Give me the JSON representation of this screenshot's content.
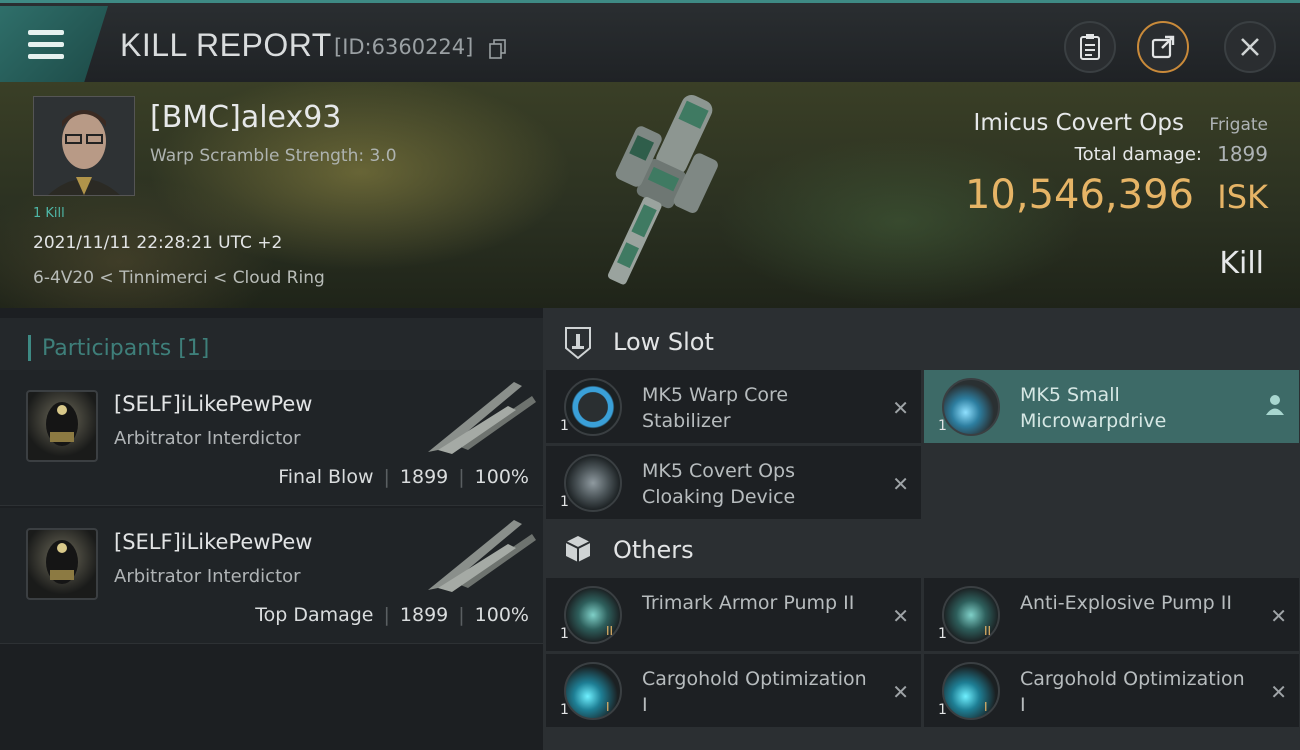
{
  "header": {
    "title": "KILL REPORT",
    "report_id": "[ID:6360224]"
  },
  "victim": {
    "pilot": "[BMC]alex93",
    "warp_scramble": "Warp Scramble Strength: 3.0",
    "kills_tag": "1 Kill",
    "datetime": "2021/11/11 22:28:21 UTC +2",
    "location": "6-4V20 < Tinnimerci < Cloud Ring",
    "ship_name": "Imicus Covert Ops",
    "ship_class": "Frigate",
    "total_damage_label": "Total damage:",
    "total_damage": "1899",
    "isk_value": "10,546,396",
    "isk_unit": "ISK",
    "result": "Kill"
  },
  "participants": {
    "header": "Participants [1]",
    "rows": [
      {
        "name": "[SELF]iLikePewPew",
        "ship": "Arbitrator Interdictor",
        "tag": "Final Blow",
        "damage": "1899",
        "percent": "100%"
      },
      {
        "name": "[SELF]iLikePewPew",
        "ship": "Arbitrator Interdictor",
        "tag": "Top Damage",
        "damage": "1899",
        "percent": "100%"
      }
    ]
  },
  "modules": {
    "low_slot_label": "Low Slot",
    "others_label": "Others",
    "low_slot": [
      {
        "qty": "1",
        "name": "MK5 Warp Core Stabilizer",
        "state": "destroyed"
      },
      {
        "qty": "1",
        "name": "MK5 Small Microwarpdrive",
        "state": "dropped"
      },
      {
        "qty": "1",
        "name": "MK5 Covert Ops Cloaking Device",
        "state": "destroyed"
      }
    ],
    "others": [
      {
        "qty": "1",
        "meta": "II",
        "name": "Trimark Armor Pump II",
        "state": "destroyed"
      },
      {
        "qty": "1",
        "meta": "II",
        "name": "Anti-Explosive Pump II",
        "state": "destroyed"
      },
      {
        "qty": "1",
        "meta": "I",
        "name": "Cargohold Optimization I",
        "state": "destroyed"
      },
      {
        "qty": "1",
        "meta": "I",
        "name": "Cargohold Optimization I",
        "state": "destroyed"
      }
    ],
    "destroyed_mark": "✕"
  },
  "colors": {
    "accent": "#3e8a84",
    "isk_gold": "#e6b466",
    "dropped_bg": "#3d6a67"
  }
}
